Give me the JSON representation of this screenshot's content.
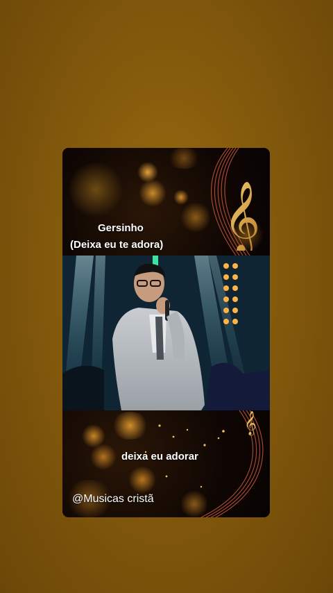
{
  "post": {
    "artist": "Gersinho",
    "song_title": "(Deixa eu te adora)",
    "lyric_line": "deixa eu adorar",
    "watermark": "@Musicas cristã"
  },
  "colors": {
    "background": "#845a0c",
    "accent_gold": "#d9a13b",
    "text": "#ffffff"
  },
  "icons": {
    "treble_clef": "treble-clef-icon"
  }
}
